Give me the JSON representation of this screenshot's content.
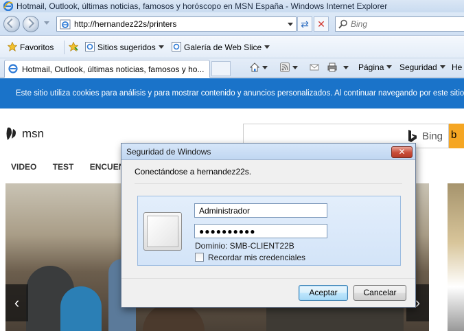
{
  "window": {
    "title": "Hotmail, Outlook, últimas noticias, famosos y horóscopo en MSN España - Windows Internet Explorer"
  },
  "address": {
    "url": "http://hernandez22s/printers",
    "search_placeholder": "Bing"
  },
  "favorites_bar": {
    "favorites_label": "Favoritos",
    "suggested_label": "Sitios sugeridos",
    "webslice_label": "Galería de Web Slice"
  },
  "tabs": [
    {
      "label": "Hotmail, Outlook, últimas noticias, famosos y ho..."
    }
  ],
  "command_bar": {
    "page_label": "Página",
    "safety_label": "Seguridad",
    "tools_partial": "He"
  },
  "page": {
    "cookie_notice": "Este sitio utiliza cookies para análisis y para mostrar contenido y anuncios personalizados. Al continuar navegando por este sitio",
    "logo_text": "msn",
    "bing_label": "Bing",
    "bing_go_partial": "b",
    "nav": [
      "VIDEO",
      "TEST",
      "ENCUEN"
    ]
  },
  "dialog": {
    "title": "Seguridad de Windows",
    "message": "Conectándose a hernandez22s.",
    "username": "Administrador",
    "password_mask": "●●●●●●●●●●",
    "domain": "Dominio: SMB-CLIENT22B",
    "remember_label": "Recordar mis credenciales",
    "remember_checked": false,
    "ok_label": "Aceptar",
    "cancel_label": "Cancelar",
    "close_glyph": "✕"
  },
  "icons": {
    "ie": "ie-logo-icon",
    "back": "back-arrow-icon",
    "forward": "forward-arrow-icon",
    "refresh": "refresh-icon",
    "stop": "stop-icon",
    "search": "search-icon",
    "favorites": "star-icon",
    "home": "home-icon",
    "feeds": "rss-icon",
    "mail": "mail-icon",
    "print": "printer-icon"
  },
  "colors": {
    "cookie_bar": "#1a73c9",
    "bing_accent": "#f5a623",
    "close_button": "#c84c39"
  }
}
